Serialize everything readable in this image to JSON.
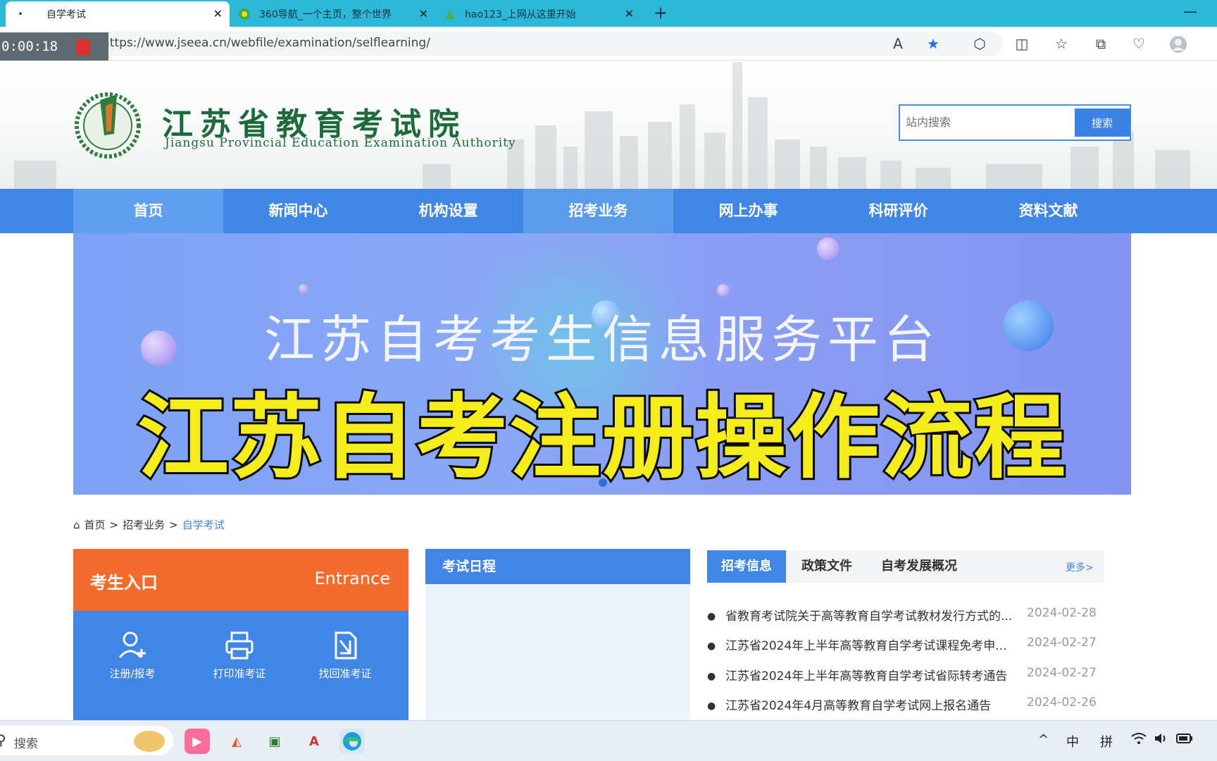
{
  "browser": {
    "tabs": [
      {
        "title": "自学考试",
        "active": true
      },
      {
        "title": "360导航_一个主页，整个世界",
        "active": false
      },
      {
        "title": "hao123_上网从这里开始",
        "active": false
      }
    ],
    "new_tab": "+",
    "minimize": "—",
    "close_glyph": "✕",
    "url": "https://www.jseea.cn/webfile/examination/selflearning/",
    "recording_timer": "0:00:18"
  },
  "site": {
    "title_cn": "江苏省教育考试院",
    "title_en": "Jiangsu Provincial Education Examination Authority",
    "search_placeholder": "站内搜索",
    "search_button": "搜索"
  },
  "nav": {
    "items": [
      "首页",
      "新闻中心",
      "机构设置",
      "招考业务",
      "网上办事",
      "科研评价",
      "资料文献"
    ]
  },
  "banner": {
    "subtitle": "江苏自考考生信息服务平台",
    "overlay_title": "江苏自考注册操作流程"
  },
  "breadcrumb": {
    "home": "首页",
    "sep": ">",
    "level2": "招考业务",
    "current": "自学考试"
  },
  "entrance": {
    "title": "考生入口",
    "title_en": "Entrance",
    "items": [
      {
        "label": "注册/报考",
        "icon": "user-add-icon"
      },
      {
        "label": "打印准考证",
        "icon": "printer-icon"
      },
      {
        "label": "找回准考证",
        "icon": "retrieve-doc-icon"
      }
    ]
  },
  "schedule": {
    "title": "考试日程"
  },
  "news": {
    "tabs": [
      "招考信息",
      "政策文件",
      "自考发展概况"
    ],
    "more": "更多>",
    "items": [
      {
        "title": "省教育考试院关于高等教育自学考试教材发行方式的...",
        "date": "2024-02-28"
      },
      {
        "title": "江苏省2024年上半年高等教育自学考试课程免考申...",
        "date": "2024-02-27"
      },
      {
        "title": "江苏省2024年上半年高等教育自学考试省际转考通告",
        "date": "2024-02-27"
      },
      {
        "title": "江苏省2024年4月高等教育自学考试网上报名通告",
        "date": "2024-02-26"
      }
    ]
  },
  "taskbar": {
    "search_label": "搜索",
    "tray": {
      "ime_lang": "中",
      "ime_mode": "拼",
      "chevron": "^"
    }
  },
  "colors": {
    "nav_blue": "#3f86e6",
    "entrance_orange": "#f46b2b",
    "banner_title_yellow": "#f5ec1c",
    "site_green": "#1d6b3a"
  }
}
